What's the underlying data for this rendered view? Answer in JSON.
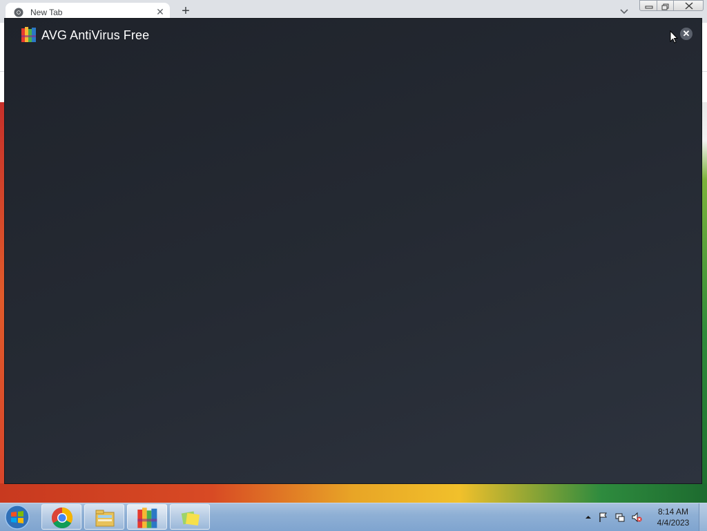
{
  "browser": {
    "tab": {
      "title": "New Tab",
      "close_glyph": "✕"
    },
    "new_tab_glyph": "+",
    "tab_search_icon": "chevron-down-icon"
  },
  "avg_dialog": {
    "title": "AVG AntiVirus Free",
    "close_glyph": "✕",
    "logo_icon": "avg-logo-icon",
    "background_color": "#252a33"
  },
  "taskbar": {
    "pinned": [
      {
        "name": "chrome",
        "icon": "chrome-icon"
      },
      {
        "name": "windows-explorer",
        "icon": "folder-icon"
      },
      {
        "name": "avg",
        "icon": "avg-logo-icon"
      },
      {
        "name": "sticky-notes",
        "icon": "sticky-notes-icon"
      }
    ],
    "clock": {
      "time": "8:14 AM",
      "date": "4/4/2023"
    }
  }
}
